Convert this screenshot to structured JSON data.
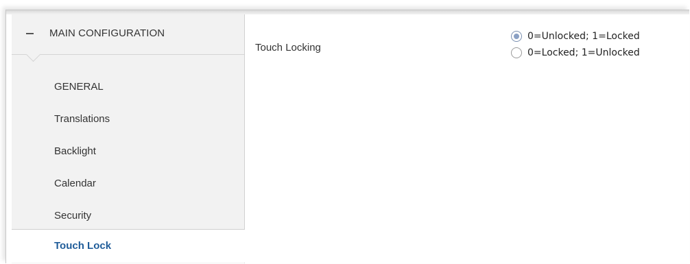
{
  "sidebar": {
    "section_title": "MAIN CONFIGURATION",
    "collapse_symbol": "−",
    "items": [
      {
        "label": "GENERAL"
      },
      {
        "label": "Translations"
      },
      {
        "label": "Backlight"
      },
      {
        "label": "Calendar"
      },
      {
        "label": "Security"
      },
      {
        "label": "Touch Lock",
        "active": true
      }
    ]
  },
  "main": {
    "parameter_label": "Touch Locking",
    "options": [
      {
        "label": "0=Unlocked; 1=Locked",
        "selected": true
      },
      {
        "label": "0=Locked; 1=Unlocked",
        "selected": false
      }
    ]
  },
  "colors": {
    "active_item": "#1f5c99",
    "sidebar_bg": "#f2f2f2",
    "radio_selected": "#8aa0c4"
  }
}
